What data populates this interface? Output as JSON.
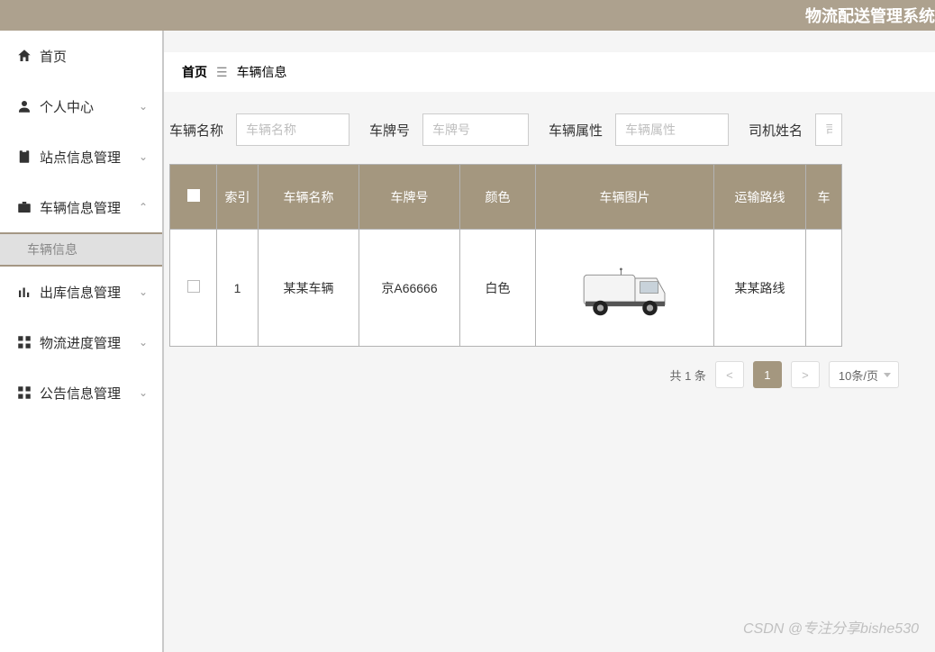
{
  "app": {
    "title": "物流配送管理系统"
  },
  "sidebar": {
    "items": [
      {
        "label": "首页",
        "icon": "home",
        "chevron": ""
      },
      {
        "label": "个人中心",
        "icon": "user",
        "chevron": "⌄"
      },
      {
        "label": "站点信息管理",
        "icon": "clipboard",
        "chevron": "⌄"
      },
      {
        "label": "车辆信息管理",
        "icon": "briefcase",
        "chevron": "⌃"
      },
      {
        "label": "出库信息管理",
        "icon": "bars",
        "chevron": "⌄"
      },
      {
        "label": "物流进度管理",
        "icon": "grid",
        "chevron": "⌄"
      },
      {
        "label": "公告信息管理",
        "icon": "grid",
        "chevron": "⌄"
      }
    ],
    "subitem": "车辆信息"
  },
  "breadcrumb": {
    "root": "首页",
    "sep": "☰",
    "current": "车辆信息"
  },
  "search": {
    "f1": {
      "label": "车辆名称",
      "placeholder": "车辆名称"
    },
    "f2": {
      "label": "车牌号",
      "placeholder": "车牌号"
    },
    "f3": {
      "label": "车辆属性",
      "placeholder": "车辆属性"
    },
    "f4": {
      "label": "司机姓名",
      "placeholder": "司机"
    }
  },
  "table": {
    "headers": {
      "h0": "",
      "h1": "索引",
      "h2": "车辆名称",
      "h3": "车牌号",
      "h4": "颜色",
      "h5": "车辆图片",
      "h6": "运输路线",
      "h7": "车"
    },
    "rows": [
      {
        "idx": "1",
        "name": "某某车辆",
        "plate": "京A66666",
        "color": "白色",
        "route": "某某路线"
      }
    ]
  },
  "pagination": {
    "total": "共 1 条",
    "prev": "<",
    "page": "1",
    "next": ">",
    "size": "10条/页"
  },
  "watermark": "CSDN @专注分享bishe530",
  "colors": {
    "brand": "#a4977f",
    "topbar": "#ada18e"
  }
}
